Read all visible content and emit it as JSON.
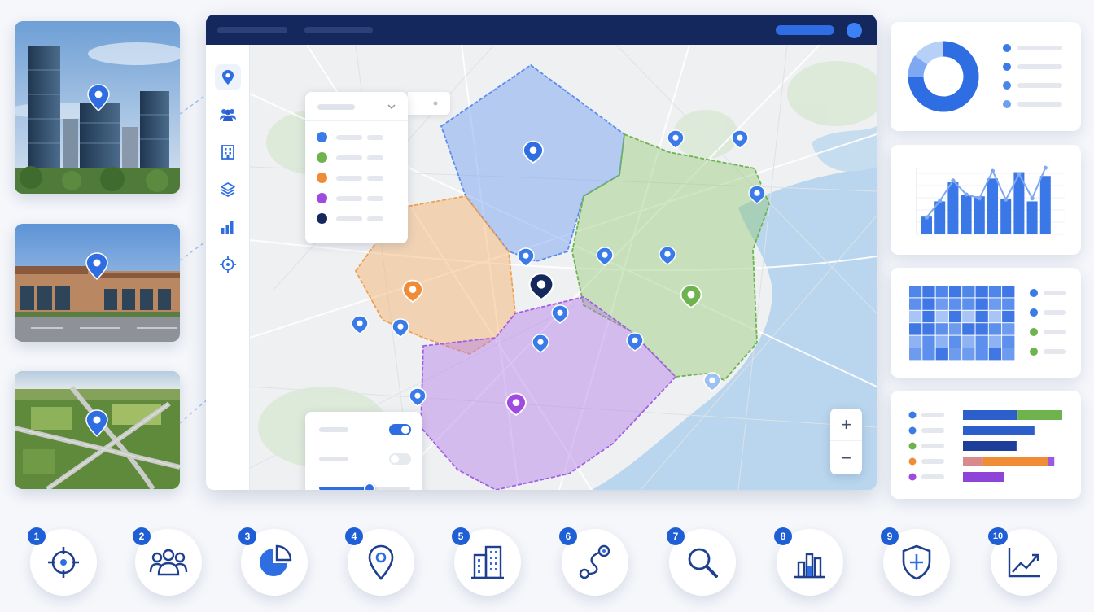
{
  "colors": {
    "header": "#14285e",
    "primary": "#2f6ee2",
    "zone_blue": "#5b8df0",
    "zone_green": "#74b355",
    "zone_orange": "#f0a050",
    "zone_purple": "#a25fe6",
    "center_pin": "#14285e"
  },
  "photos": [
    {
      "scene": "downtown-office-towers",
      "pin": "blue-location-pin"
    },
    {
      "scene": "retail-shopping-plaza",
      "pin": "blue-location-pin"
    },
    {
      "scene": "aerial-highway-interchange",
      "pin": "blue-location-pin"
    }
  ],
  "side_rail": {
    "items": [
      {
        "icon": "location-pin-icon",
        "active": true
      },
      {
        "icon": "users-icon",
        "active": false
      },
      {
        "icon": "building-icon",
        "active": false
      },
      {
        "icon": "layers-icon",
        "active": false
      },
      {
        "icon": "bar-chart-icon",
        "active": false
      },
      {
        "icon": "crosshair-icon",
        "active": false
      }
    ]
  },
  "legend": {
    "items": [
      {
        "color": "#3b7be8"
      },
      {
        "color": "#6fb34f"
      },
      {
        "color": "#f08c36"
      },
      {
        "color": "#a04ae0"
      },
      {
        "color": "#14285e"
      }
    ]
  },
  "map_controls": {
    "toggles": [
      {
        "on": true
      },
      {
        "on": false
      }
    ],
    "slider_value": 0.55
  },
  "zoom": {
    "in_label": "+",
    "out_label": "−"
  },
  "widgets": {
    "donut": {
      "fraction": 0.75,
      "legend_dots": [
        "#3b7be8",
        "#3b7be8",
        "#4a86ea",
        "#6ea0ef"
      ]
    },
    "combo_bars": {
      "values": [
        0.28,
        0.52,
        0.82,
        0.62,
        0.6,
        0.88,
        0.56,
        0.98,
        0.52,
        0.92
      ],
      "line": [
        0.32,
        0.58,
        0.9,
        0.68,
        0.62,
        1.05,
        0.6,
        1.0,
        0.62,
        1.1
      ]
    },
    "heatmap": {
      "legend_dots": [
        "#3b7be8",
        "#3b7be8",
        "#6fb34f",
        "#6fb34f"
      ]
    },
    "hbars": {
      "rows": [
        {
          "dot": "#3b7be8",
          "segments": [
            {
              "color": "#2c5fc9",
              "value": 0.55
            },
            {
              "color": "#6fb34f",
              "value": 0.45
            }
          ]
        },
        {
          "dot": "#3b7be8",
          "segments": [
            {
              "color": "#2c5fc9",
              "value": 0.72
            }
          ]
        },
        {
          "dot": "#6fb34f",
          "segments": [
            {
              "color": "#1e3f99",
              "value": 0.54
            }
          ]
        },
        {
          "dot": "#f08c36",
          "segments": [
            {
              "color": "#d98b8b",
              "value": 0.2
            },
            {
              "color": "#f08c36",
              "value": 0.66
            },
            {
              "color": "#9b59e0",
              "value": 0.06
            }
          ]
        },
        {
          "dot": "#a04ae0",
          "segments": [
            {
              "color": "#8e44d6",
              "value": 0.41
            }
          ]
        }
      ]
    }
  },
  "features": [
    {
      "number": "1",
      "icon": "crosshair-icon"
    },
    {
      "number": "2",
      "icon": "users-group-icon"
    },
    {
      "number": "3",
      "icon": "pie-chart-icon"
    },
    {
      "number": "4",
      "icon": "map-pin-icon"
    },
    {
      "number": "5",
      "icon": "building-icon"
    },
    {
      "number": "6",
      "icon": "route-icon"
    },
    {
      "number": "7",
      "icon": "search-icon"
    },
    {
      "number": "8",
      "icon": "bar-chart-icon"
    },
    {
      "number": "9",
      "icon": "shield-icon"
    },
    {
      "number": "10",
      "icon": "trend-line-icon"
    }
  ]
}
